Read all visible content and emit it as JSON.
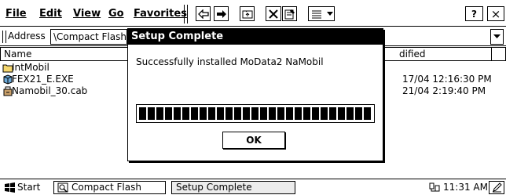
{
  "menubar": {
    "file": "File",
    "edit": "Edit",
    "view": "View",
    "go": "Go",
    "favorites": "Favorites"
  },
  "toolbar": {
    "help_label": "?",
    "close_label": "×"
  },
  "address": {
    "label": "Address",
    "value": "\\Compact Flash"
  },
  "columns": {
    "name": "Name",
    "modified": "dified"
  },
  "files": [
    {
      "name": "IntMobil",
      "date": "",
      "icon": "folder-icon"
    },
    {
      "name": "FEX21_E.EXE",
      "date": "17/04 12:16:30 PM",
      "icon": "exe-icon"
    },
    {
      "name": "Namobil_30.cab",
      "date": "21/04 2:19:40 PM",
      "icon": "cab-icon"
    }
  ],
  "dialog": {
    "title": "Setup Complete",
    "message": "Successfully installed MoData2 NaMobil",
    "progress": 1.0,
    "ok_label": "OK"
  },
  "taskbar": {
    "start": "Start",
    "window1": "Compact Flash",
    "window2": "Setup Complete",
    "clock": "11:31 AM"
  }
}
